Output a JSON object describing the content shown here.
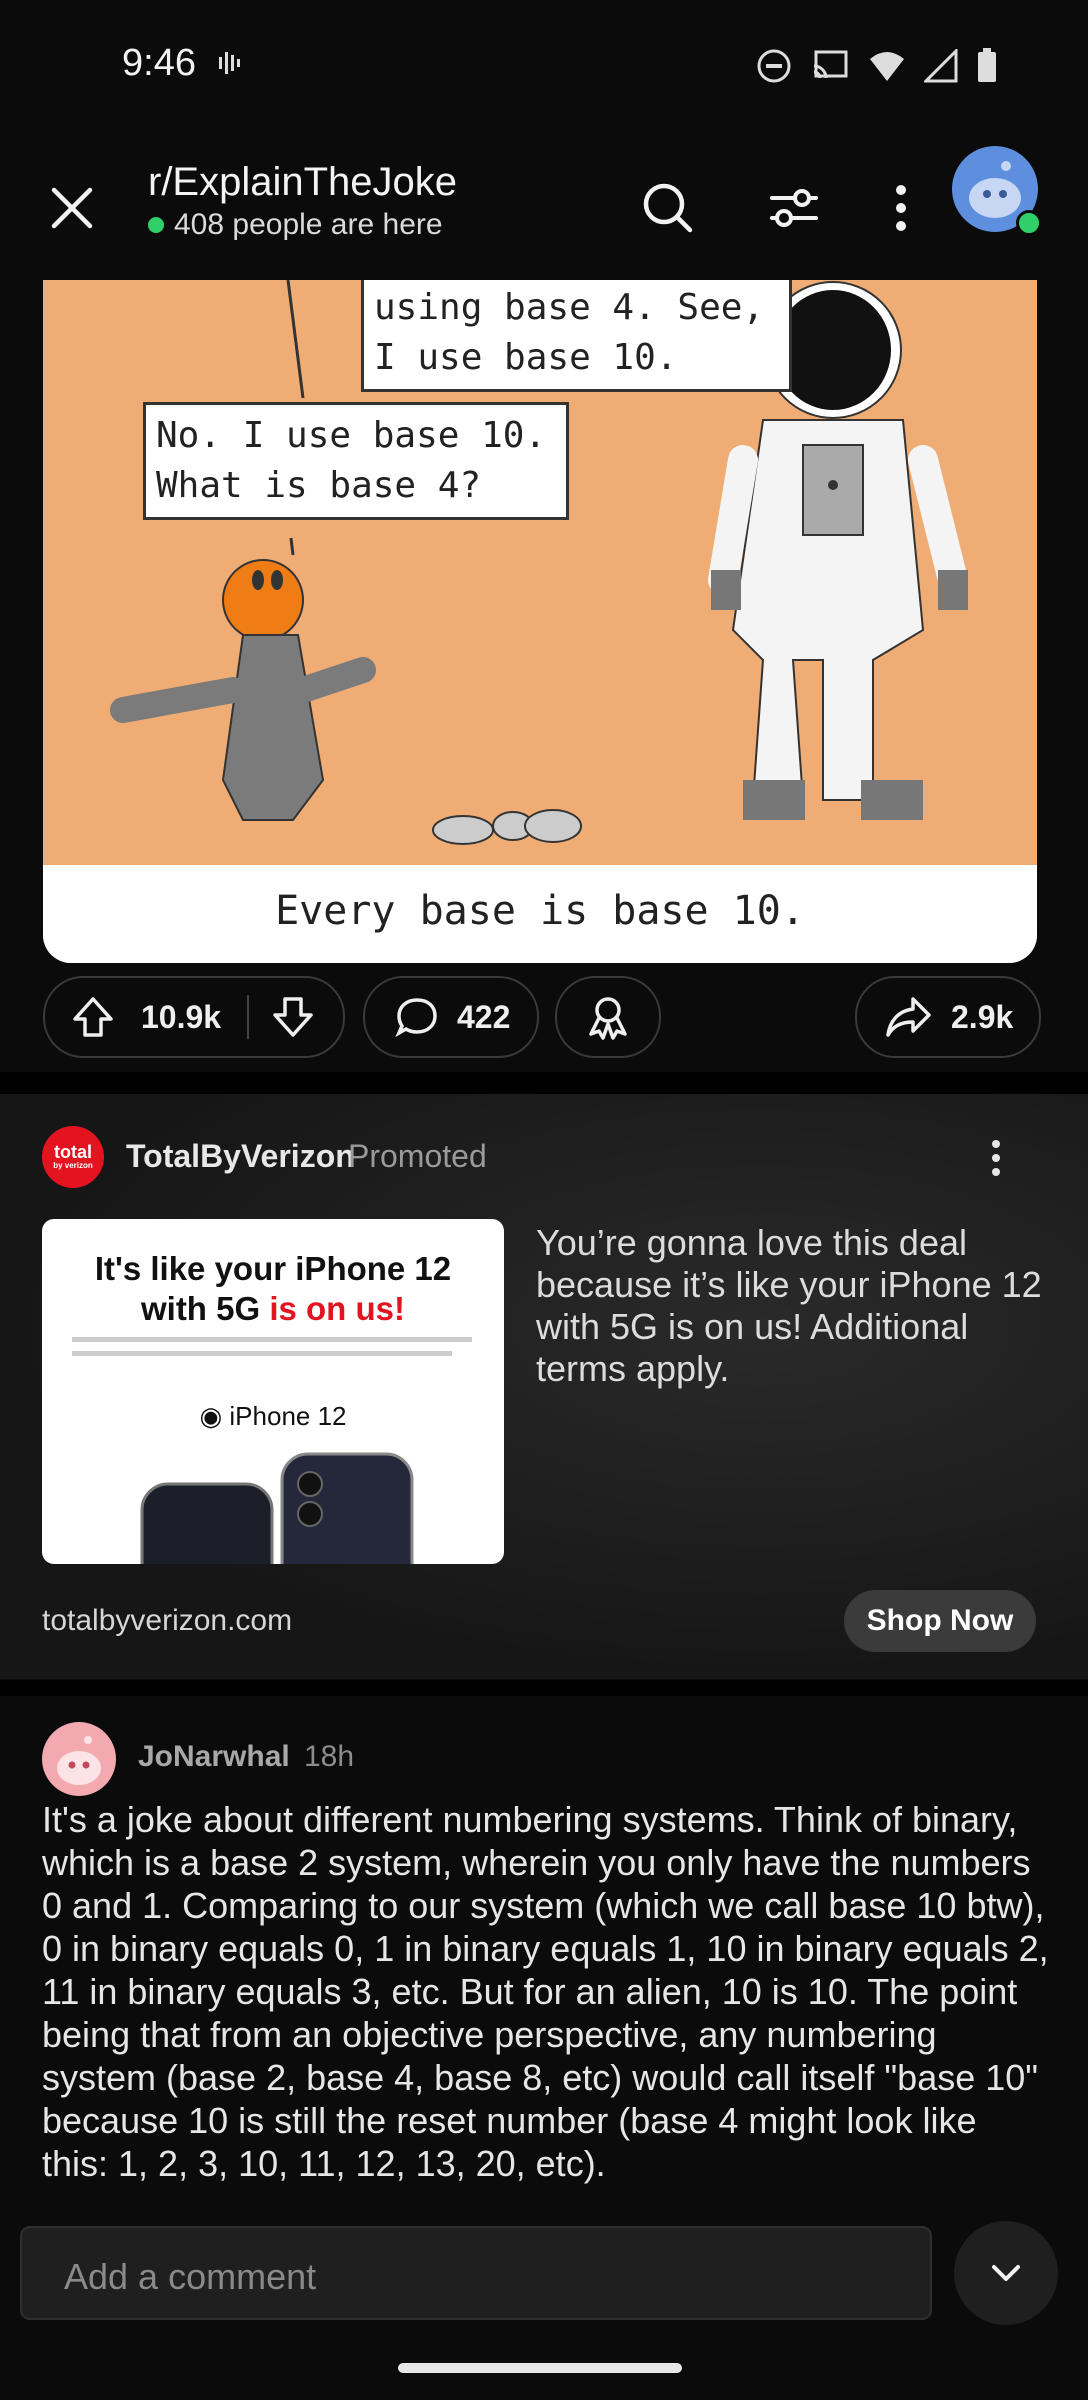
{
  "status_bar": {
    "time": "9:46"
  },
  "header": {
    "subreddit": "r/ExplainTheJoke",
    "online": "408 people are here"
  },
  "comic": {
    "bubble_top_line1": "using base 4.  See,",
    "bubble_top_line2": "I use base 10.",
    "bubble_left_line1": "No.  I use base 10.",
    "bubble_left_line2": "What is base 4?",
    "caption": "Every base is base 10."
  },
  "actions": {
    "upvotes": "10.9k",
    "comments": "422",
    "shares": "2.9k"
  },
  "ad": {
    "advertiser": "TotalByVerizon",
    "promoted": "Promoted",
    "logo_line1": "total",
    "logo_line2": "by verizon",
    "headline_part1": "It's like your iPhone 12",
    "headline_part2": "with 5G ",
    "headline_part3": "is on us!",
    "product": "iPhone 12",
    "description": "You’re gonna love this deal because it’s like your iPhone 12 with 5G is on us! Additional terms apply.",
    "domain": "totalbyverizon.com",
    "cta": "Shop Now"
  },
  "comment": {
    "author": "JoNarwhal",
    "time": "18h",
    "body": "It's a joke about different numbering systems. Think of binary, which is a base 2 system, wherein you only have the numbers 0 and 1. Comparing to our system (which we call base 10 btw), 0 in binary equals 0, 1 in binary equals 1, 10 in binary equals 2, 11 in binary equals 3, etc. But for an alien, 10 is 10. The point being that from an objective perspective, any numbering system (base 2, base 4, base 8, etc) would call itself \"base 10\" because 10 is still the reset number (base 4 might look like this: 1, 2, 3, 10, 11, 12, 13, 20, etc)."
  },
  "composer": {
    "placeholder": "Add a comment"
  },
  "colors": {
    "background": "#0b0b0b",
    "online_green": "#2fd06a",
    "verizon_red": "#e3141f",
    "comic_bg": "#efac75"
  }
}
